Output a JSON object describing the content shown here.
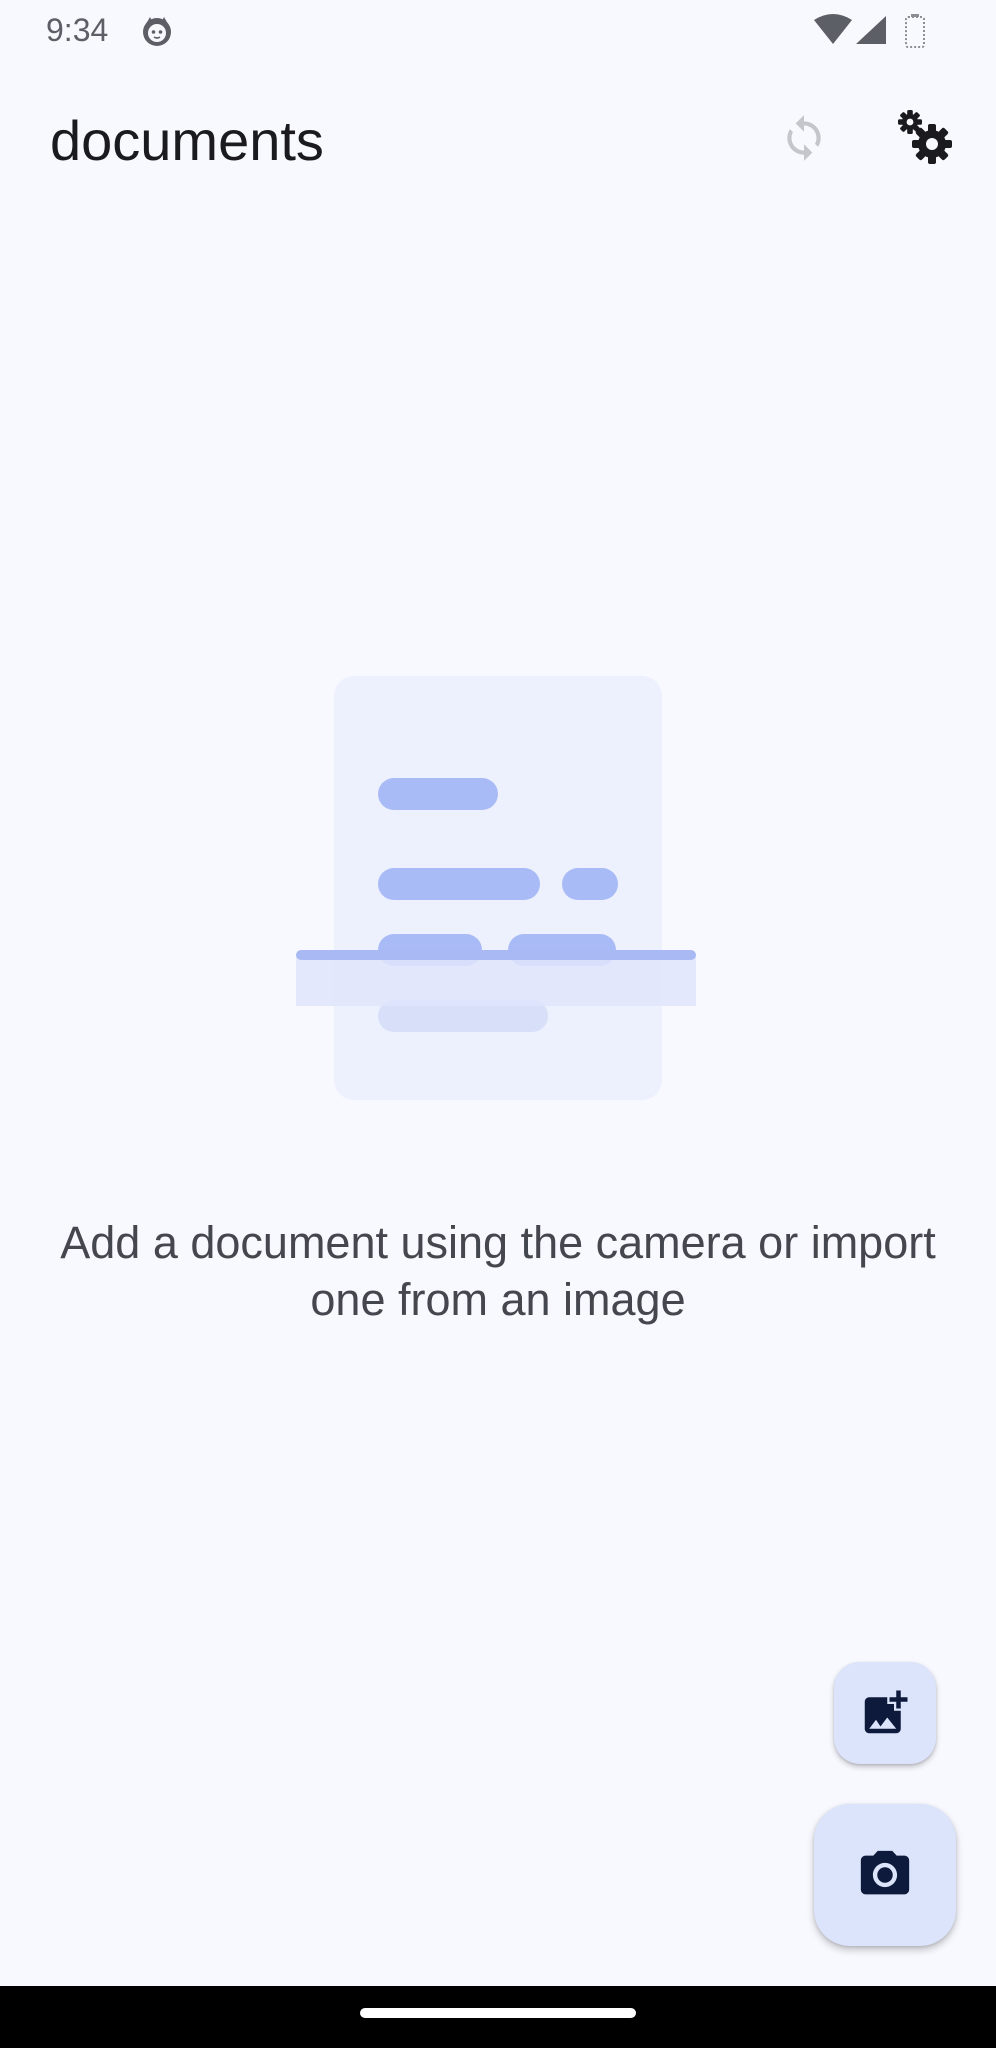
{
  "status_bar": {
    "time": "9:34",
    "icons": [
      "cat-notification-icon",
      "wifi-icon",
      "signal-icon",
      "battery-icon"
    ]
  },
  "app_bar": {
    "title": "documents",
    "actions": [
      {
        "name": "sync",
        "icon": "sync-icon",
        "enabled": false
      },
      {
        "name": "settings",
        "icon": "settings-gears-icon",
        "enabled": true
      }
    ]
  },
  "empty_state": {
    "illustration": "document-scan-illustration",
    "message": "Add a document using the camera or import one from an image"
  },
  "fabs": {
    "import": {
      "icon": "add-photo-icon"
    },
    "camera": {
      "icon": "camera-icon"
    }
  },
  "colors": {
    "background": "#f8f9ff",
    "fab_container": "#dce4fb",
    "fab_icon": "#0e1a3c",
    "illustration_page": "#edf0fd",
    "illustration_lines": "#a9bbf7",
    "illustration_scanline": "#a8b9f3"
  }
}
